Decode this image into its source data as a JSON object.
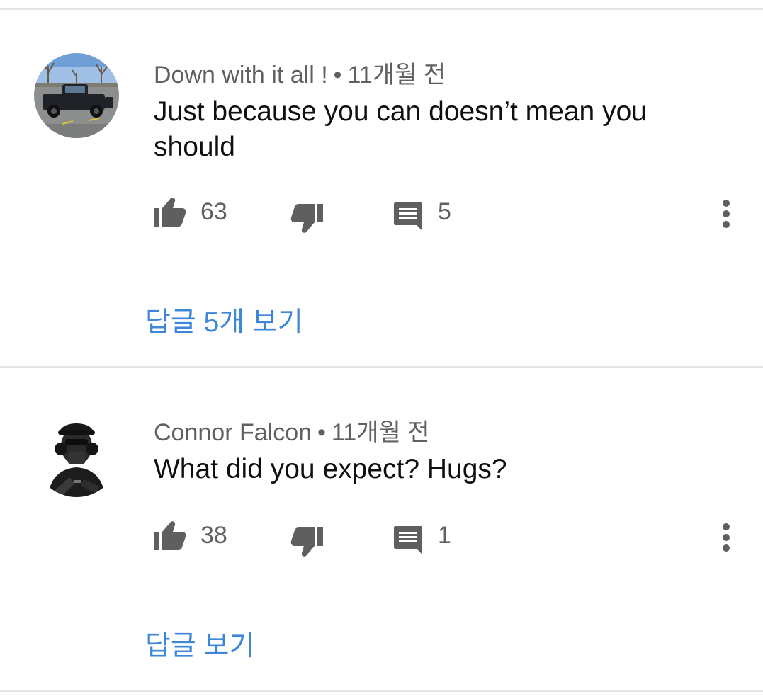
{
  "comments": [
    {
      "author": "Down with it all !",
      "separator": "•",
      "time": "11개월 전",
      "text": "Just because you can doesn’t mean you should",
      "likes": "63",
      "replies_count": "5",
      "view_replies": "답글 5개 보기",
      "avatar_icon": "pickup-truck-photo"
    },
    {
      "author": "Connor Falcon",
      "separator": "•",
      "time": "11개월 전",
      "text": "What did you expect? Hugs?",
      "likes": "38",
      "replies_count": "1",
      "view_replies": "답글 보기",
      "avatar_icon": "soldier-photo"
    }
  ],
  "icons": {
    "like": "thumbs-up-icon",
    "dislike": "thumbs-down-icon",
    "reply": "comment-icon",
    "menu": "more-vert-icon"
  },
  "colors": {
    "link": "#3e86d8",
    "meta": "#606060",
    "icon": "#5f5f5f",
    "divider": "#e6e6e6"
  }
}
